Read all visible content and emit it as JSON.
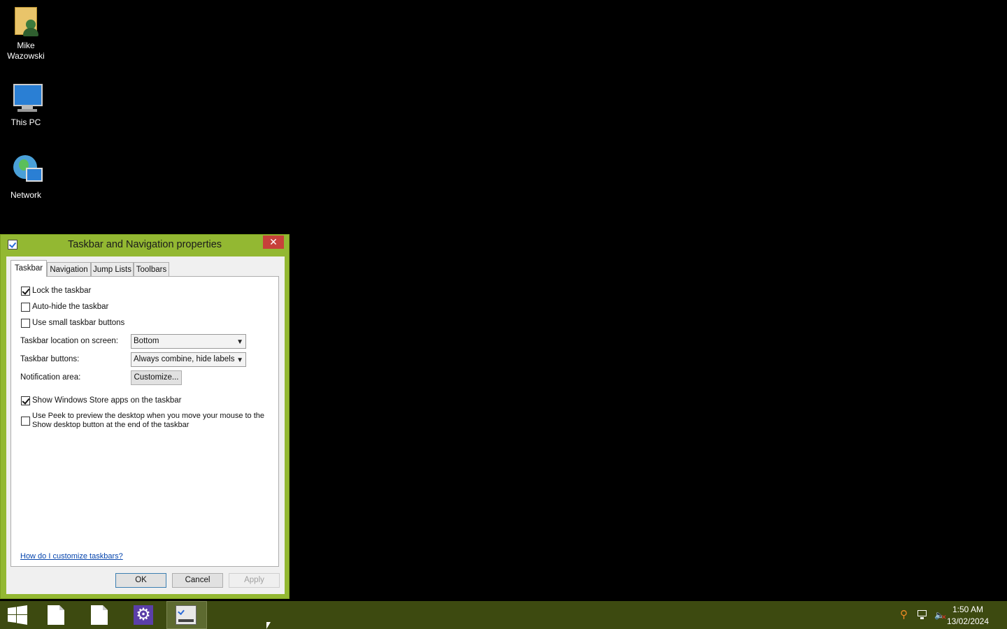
{
  "desktop": {
    "icons": [
      {
        "label": "Mike Wazowski",
        "icon": "user-folder-icon"
      },
      {
        "label": "This PC",
        "icon": "computer-icon"
      },
      {
        "label": "Network",
        "icon": "network-icon"
      }
    ]
  },
  "window": {
    "title": "Taskbar and Navigation properties",
    "close_label": "✕",
    "tabs": [
      "Taskbar",
      "Navigation",
      "Jump Lists",
      "Toolbars"
    ],
    "active_tab": "Taskbar",
    "checkboxes": {
      "lock": {
        "label": "Lock the taskbar",
        "checked": true
      },
      "autohide": {
        "label": "Auto-hide the taskbar",
        "checked": false
      },
      "small": {
        "label": "Use small taskbar buttons",
        "checked": false
      },
      "store": {
        "label": "Show Windows Store apps on the taskbar",
        "checked": true
      },
      "peek": {
        "label": "Use Peek to preview the desktop when you move your mouse to the Show desktop button at the end of the taskbar",
        "checked": false
      }
    },
    "location": {
      "label": "Taskbar location on screen:",
      "value": "Bottom"
    },
    "buttons": {
      "label": "Taskbar buttons:",
      "value": "Always combine, hide labels"
    },
    "notification": {
      "label": "Notification area:",
      "button": "Customize..."
    },
    "help_link": "How do I customize taskbars?",
    "ok": "OK",
    "cancel": "Cancel",
    "apply": "Apply"
  },
  "taskbar": {
    "color": "#3d4a10",
    "time": "1:50 AM",
    "date": "13/02/2024"
  },
  "colors": {
    "window_frame": "#93b832"
  }
}
